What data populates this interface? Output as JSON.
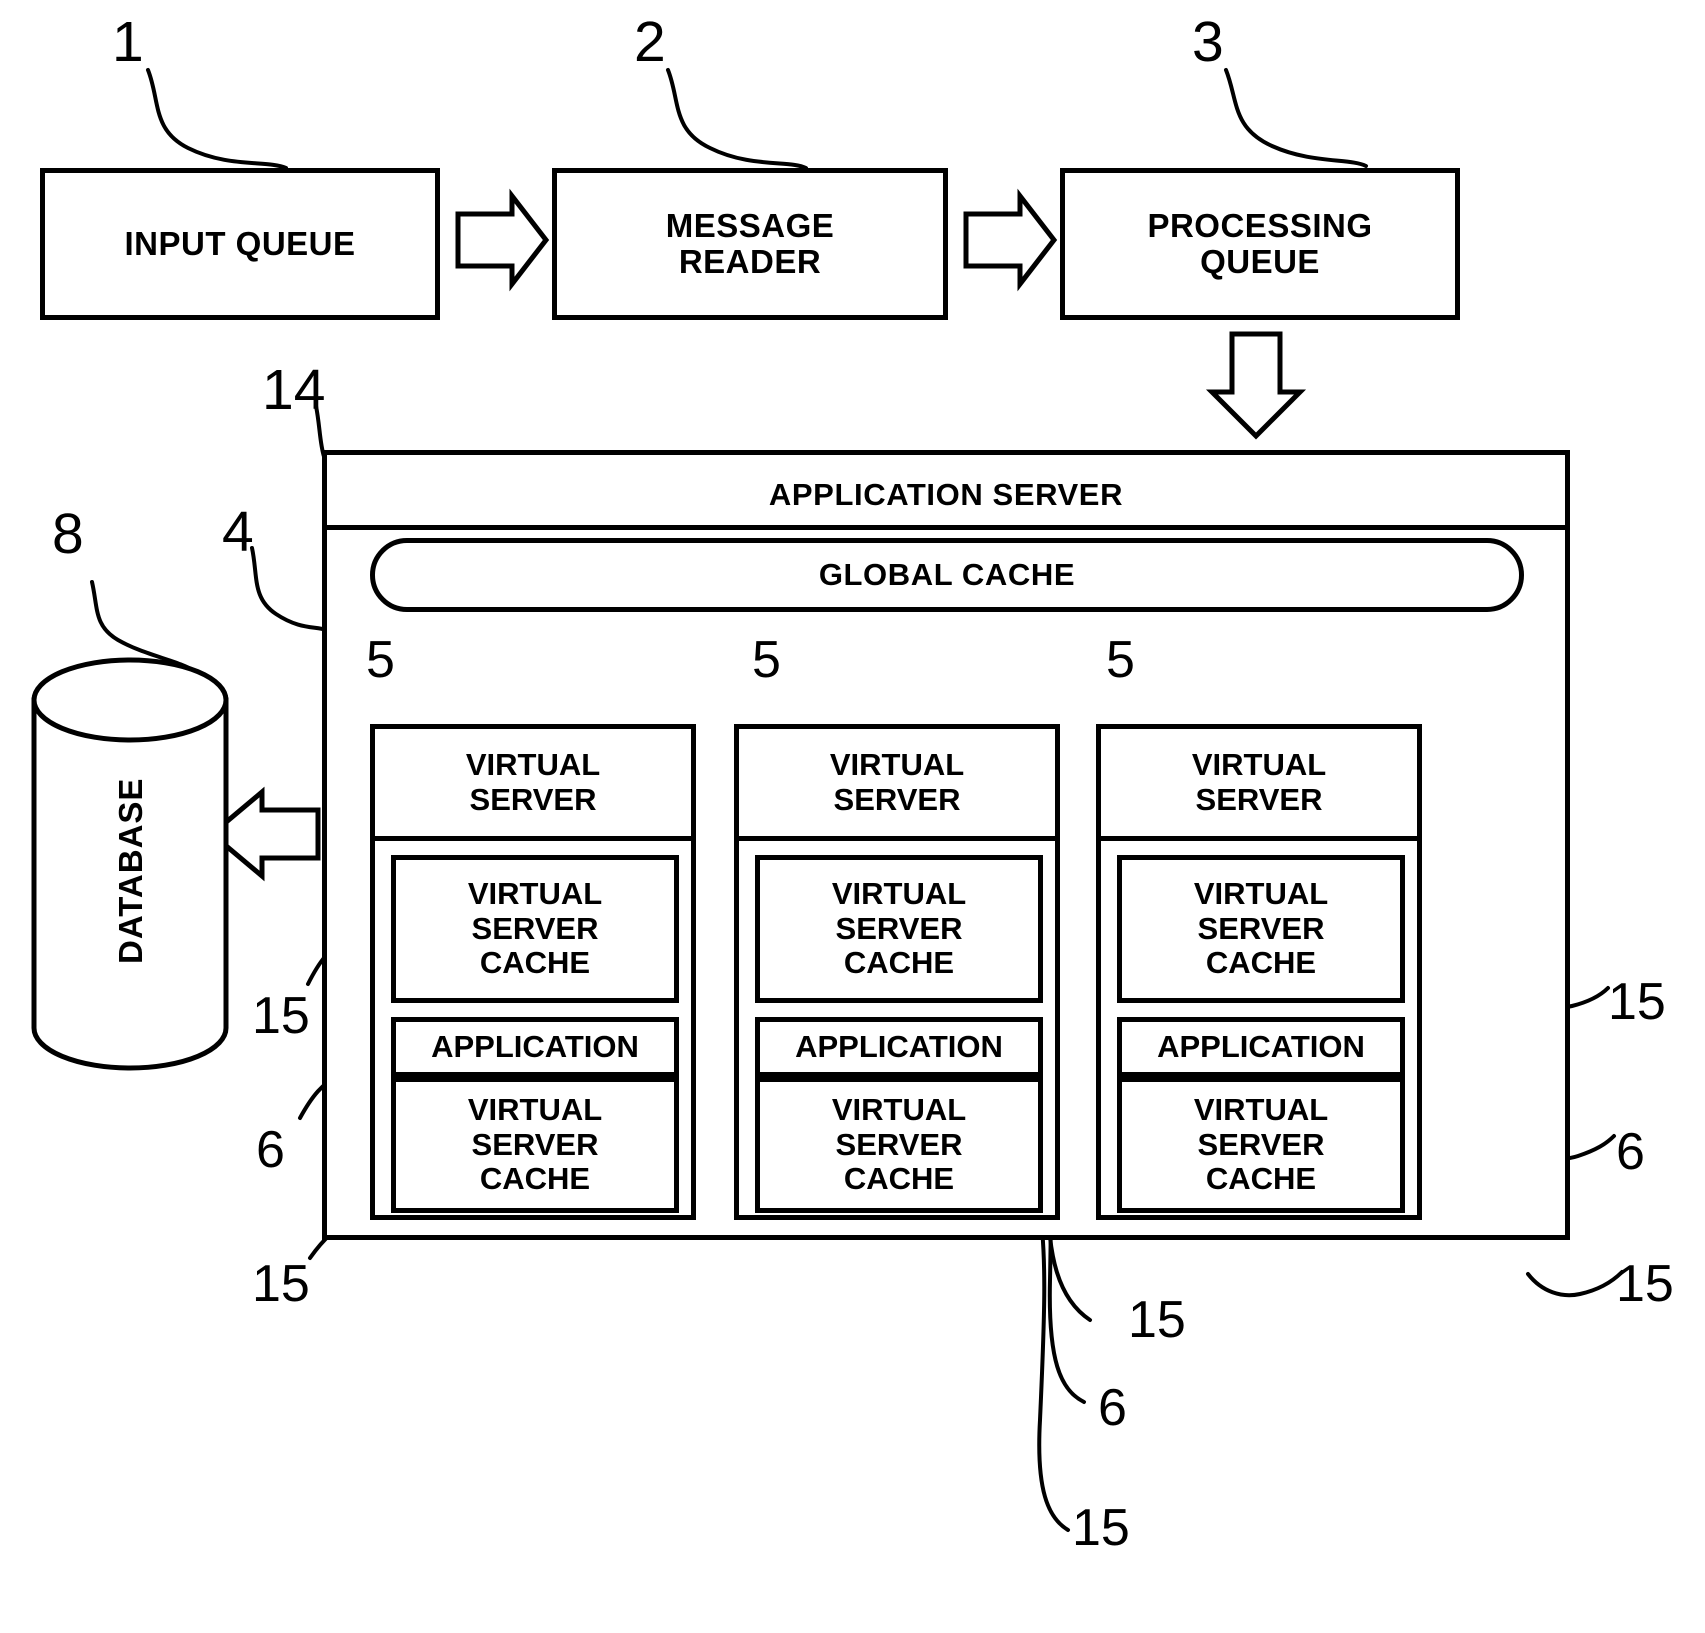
{
  "figure": {
    "type": "patent-block-diagram",
    "background": "#ffffff",
    "line_color": "#000000"
  },
  "pipeline": {
    "input_queue": {
      "label": "INPUT QUEUE",
      "ref": "1"
    },
    "message_reader": {
      "label": "MESSAGE\nREADER",
      "line1": "MESSAGE",
      "line2": "READER",
      "ref": "2"
    },
    "processing_queue": {
      "label": "PROCESSING\nQUEUE",
      "line1": "PROCESSING",
      "line2": "QUEUE",
      "ref": "3"
    }
  },
  "database": {
    "label": "DATABASE",
    "ref": "8"
  },
  "application_server": {
    "title": "APPLICATION SERVER",
    "ref_outer": "4",
    "ref_title": "14",
    "global_cache": {
      "label": "GLOBAL CACHE"
    },
    "columns": [
      {
        "ref": "5",
        "header_line1": "VIRTUAL",
        "header_line2": "SERVER",
        "cache_top": {
          "line1": "VIRTUAL",
          "line2": "SERVER",
          "line3": "CACHE",
          "ref": "15"
        },
        "application": {
          "label": "APPLICATION",
          "ref": "6"
        },
        "cache_bottom": {
          "line1": "VIRTUAL",
          "line2": "SERVER",
          "line3": "CACHE",
          "ref": "15"
        }
      },
      {
        "ref": "5",
        "header_line1": "VIRTUAL",
        "header_line2": "SERVER",
        "cache_top": {
          "line1": "VIRTUAL",
          "line2": "SERVER",
          "line3": "CACHE",
          "ref": "15"
        },
        "application": {
          "label": "APPLICATION",
          "ref": "6"
        },
        "cache_bottom": {
          "line1": "VIRTUAL",
          "line2": "SERVER",
          "line3": "CACHE",
          "ref": "15"
        }
      },
      {
        "ref": "5",
        "header_line1": "VIRTUAL",
        "header_line2": "SERVER",
        "cache_top": {
          "line1": "VIRTUAL",
          "line2": "SERVER",
          "line3": "CACHE",
          "ref": "15"
        },
        "application": {
          "label": "APPLICATION",
          "ref": "6"
        },
        "cache_bottom": {
          "line1": "VIRTUAL",
          "line2": "SERVER",
          "line3": "CACHE",
          "ref": "15"
        }
      }
    ]
  },
  "reference_numerals": {
    "n1": "1",
    "n2": "2",
    "n3": "3",
    "n4": "4",
    "n5a": "5",
    "n5b": "5",
    "n5c": "5",
    "n6_left": "6",
    "n6_center": "6",
    "n6_right": "6",
    "n8": "8",
    "n14": "14",
    "n15_left_upper": "15",
    "n15_left_lower": "15",
    "n15_center_upper": "15",
    "n15_center_lower": "15",
    "n15_right_upper": "15",
    "n15_right_lower": "15"
  },
  "arrows": {
    "input_to_reader": "arrow-right",
    "reader_to_queue": "arrow-right",
    "queue_to_appserver": "arrow-down",
    "appserver_to_database": "arrow-left",
    "cache_to_vs1": "arrow-down",
    "cache_to_vs2": "arrow-down",
    "cache_to_vs3": "arrow-down"
  }
}
